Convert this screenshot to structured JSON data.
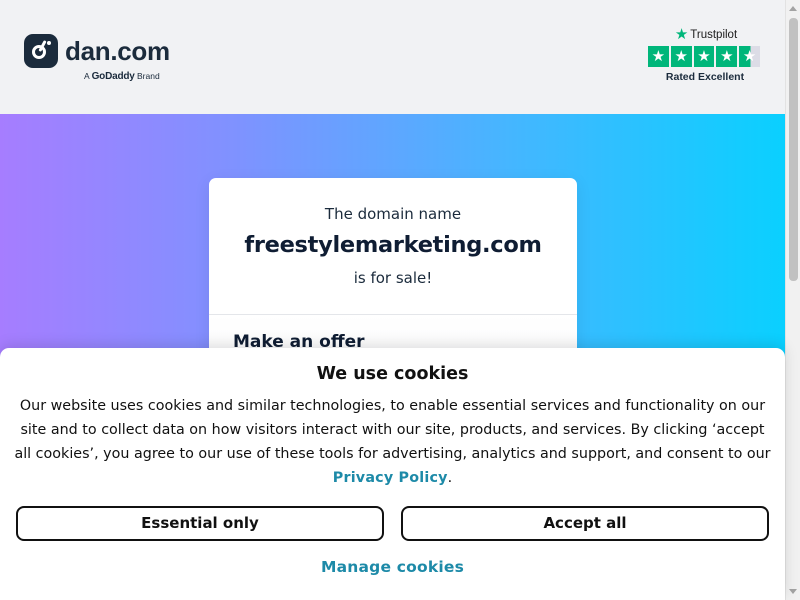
{
  "header": {
    "logo_text": "dan.com",
    "godaddy_prefix": "A",
    "godaddy_brand": "GoDaddy",
    "godaddy_suffix": "Brand",
    "trustpilot": {
      "name": "Trustpilot",
      "rating_text": "Rated Excellent",
      "stars": 4.5,
      "star_color": "#00b67a"
    }
  },
  "domain_card": {
    "line1": "The domain name",
    "domain": "freestylemarketing.com",
    "line3": "is for sale!",
    "offer_heading": "Make an offer"
  },
  "cookie_banner": {
    "title": "We use cookies",
    "body": "Our website uses cookies and similar technologies, to enable essential services and functionality on our site and to collect data on how visitors interact with our site, products, and services. By clicking ‘accept all cookies’, you agree to our use of these tools for advertising, analytics and support, and consent to our",
    "policy_link": "Privacy Policy",
    "policy_suffix": ".",
    "essential_button": "Essential only",
    "accept_button": "Accept all",
    "manage_link": "Manage cookies",
    "link_color": "#1d8aa8"
  },
  "colors": {
    "gradient_start": "#a67dff",
    "gradient_end": "#0ad0ff",
    "header_bg": "#f1f2f4",
    "brand_dark": "#1b2b3c"
  }
}
